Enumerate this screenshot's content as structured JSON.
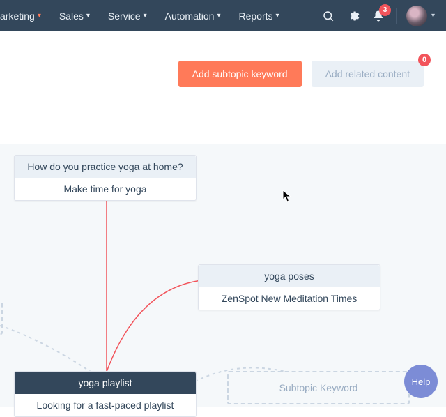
{
  "nav": {
    "items": [
      {
        "label": "arketing",
        "accent": true
      },
      {
        "label": "Sales"
      },
      {
        "label": "Service"
      },
      {
        "label": "Automation"
      },
      {
        "label": "Reports"
      }
    ],
    "notif_count": "3"
  },
  "actions": {
    "add_subtopic": "Add subtopic keyword",
    "add_related": "Add related content",
    "related_badge": "0"
  },
  "nodes": {
    "n1": {
      "head": "How do you practice yoga at home?",
      "body": "Make time for yoga"
    },
    "n2": {
      "head": "yoga poses",
      "body": "ZenSpot New Meditation Times"
    },
    "n3": {
      "head": "yoga playlist",
      "body": "Looking for a fast-paced playlist"
    },
    "n4": {
      "head": "Subtopic Keyword"
    }
  },
  "help": "Help"
}
